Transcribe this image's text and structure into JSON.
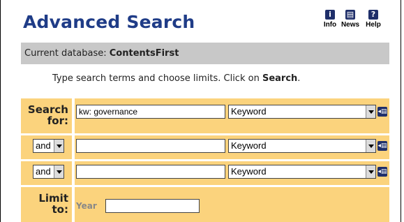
{
  "page": {
    "title": "Advanced Search"
  },
  "toolbar": {
    "info_label": "Info",
    "news_label": "News",
    "help_label": "Help",
    "info_icon": "info-icon",
    "news_icon": "news-icon",
    "help_icon": "help-icon"
  },
  "database": {
    "prefix": "Current database: ",
    "name": "ContentsFirst"
  },
  "instructions": {
    "text": "Type search terms and choose limits. Click on ",
    "emphasis": "Search",
    "suffix": "."
  },
  "search": {
    "label": "Search for:",
    "rows": [
      {
        "operator": null,
        "term": "kw: governance",
        "field": "Keyword"
      },
      {
        "operator": "and",
        "term": "",
        "field": "Keyword"
      },
      {
        "operator": "and",
        "term": "",
        "field": "Keyword"
      }
    ]
  },
  "limit": {
    "label": "Limit to:",
    "year_label": "Year",
    "year_value": ""
  },
  "colors": {
    "title": "#1f3c87",
    "panel": "#fbd37d",
    "dbbar": "#c8c8c8",
    "icon": "#1f2f6a"
  }
}
